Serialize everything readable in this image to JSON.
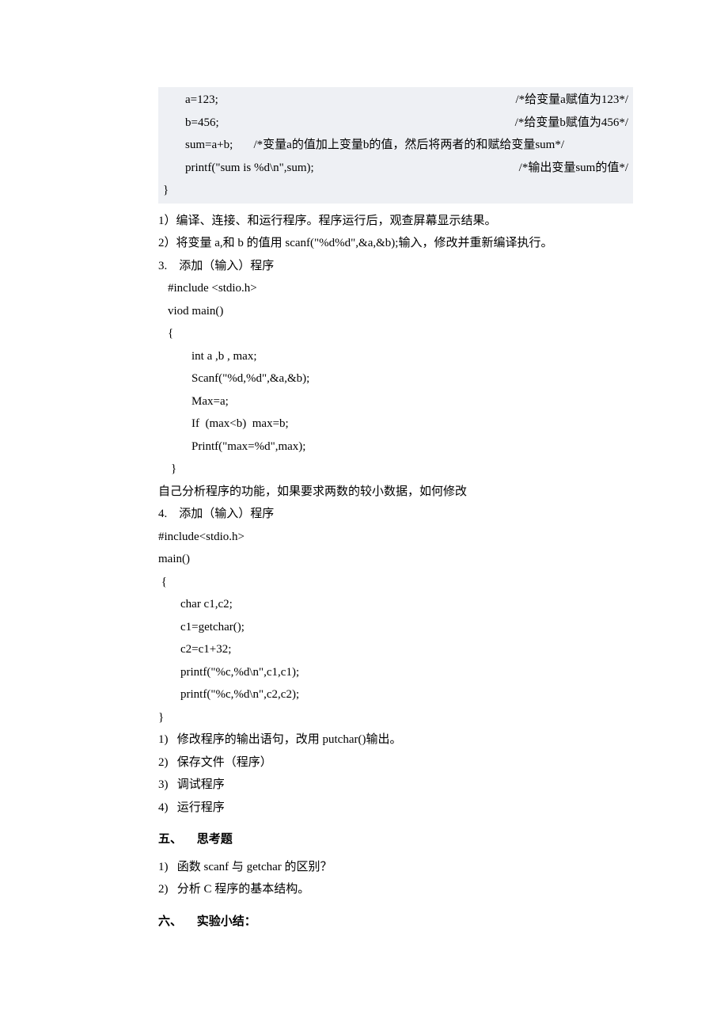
{
  "codeblock": {
    "l1_left": "a=123;",
    "l1_right": "/*给变量a赋值为123*/",
    "l2_left": "b=456;",
    "l2_right": "/*给变量b赋值为456*/",
    "l3_full": "sum=a+b;       /*变量a的值加上变量b的值，然后将两者的和赋给变量sum*/",
    "l4_left": "printf(\"sum is %d\\n\",sum);",
    "l4_right": "/*输出变量sum的值*/",
    "l5": "}"
  },
  "para1": {
    "l1": "1）编译、连接、和运行程序。程序运行后，观查屏幕显示结果。",
    "l2": "2）将变量 a,和 b 的值用 scanf(\"%d%d\",&a,&b);输入，修改并重新编译执行。"
  },
  "sec3": {
    "title": "3.    添加（输入）程序",
    "c1": "#include <stdio.h>",
    "c2": "viod main()",
    "c3": "{",
    "c4": "int a ,b , max;",
    "c5": "Scanf(\"%d,%d\",&a,&b);",
    "c6": "Max=a;",
    "c7": "If  (max<b)  max=b;",
    "c8": "Printf(\"max=%d\",max);",
    "c9": "}",
    "note": "自己分析程序的功能，如果要求两数的较小数据，如何修改"
  },
  "sec4": {
    "title": "4.    添加（输入）程序",
    "c1": "#include<stdio.h>",
    "c2": "main()",
    "c3": " {",
    "c4": "char c1,c2;",
    "c5": "c1=getchar();",
    "c6": "c2=c1+32;",
    "c7": "printf(\"%c,%d\\n\",c1,c1);",
    "c8": "printf(\"%c,%d\\n\",c2,c2);",
    "c9": "}",
    "q1": "1)   修改程序的输出语句，改用 putchar()输出。",
    "q2": "2)   保存文件（程序）",
    "q3": "3)   调试程序",
    "q4": "4)   运行程序"
  },
  "sec5": {
    "title": "五、     思考题",
    "q1": "1)   函数 scanf 与 getchar 的区别？",
    "q2": "2)   分析 C 程序的基本结构。"
  },
  "sec6": {
    "title": "六、     实验小结："
  }
}
